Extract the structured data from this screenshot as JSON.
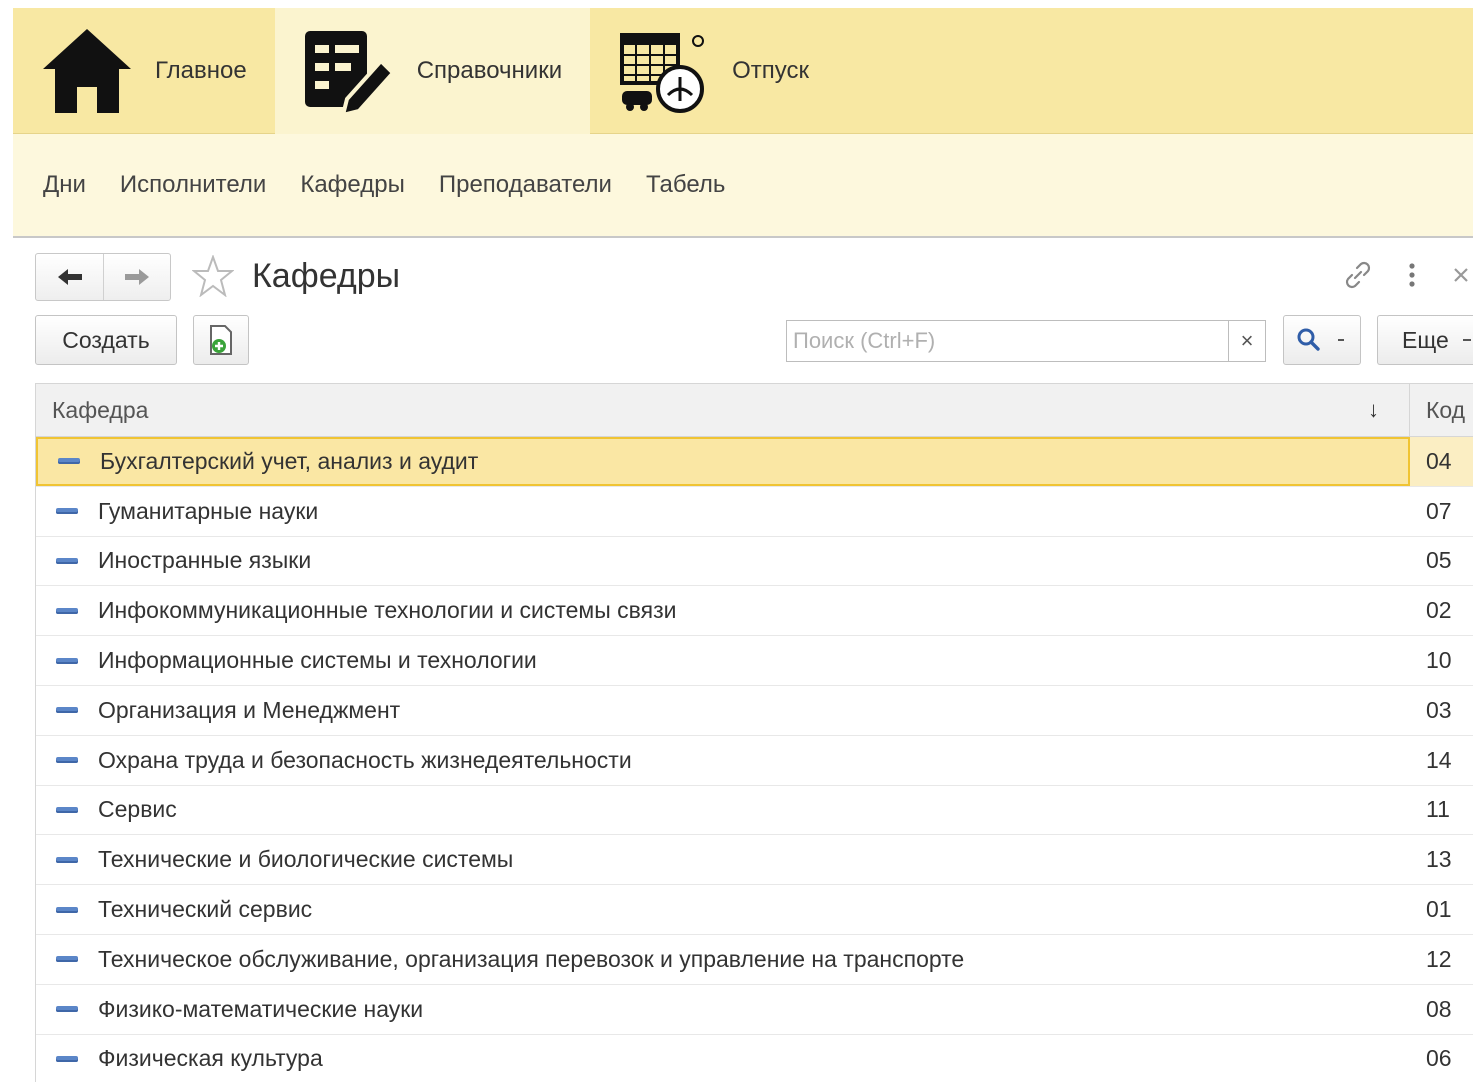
{
  "sections": [
    {
      "label": "Главное",
      "icon": "home-icon"
    },
    {
      "label": "Справочники",
      "icon": "catalog-edit-icon"
    },
    {
      "label": "Отпуск",
      "icon": "vacation-calendar-icon"
    }
  ],
  "subnav": [
    "Дни",
    "Исполнители",
    "Кафедры",
    "Преподаватели",
    "Табель"
  ],
  "form": {
    "title": "Кафедры",
    "create_label": "Создать",
    "search_placeholder": "Поиск (Ctrl+F)",
    "search_clear": "×",
    "more_label": "Еще"
  },
  "table": {
    "columns": [
      "Кафедра",
      "Код"
    ],
    "sort_indicator": "↓",
    "rows": [
      {
        "name": "Бухгалтерский учет, анализ и аудит",
        "code": "04",
        "selected": true
      },
      {
        "name": "Гуманитарные науки",
        "code": "07"
      },
      {
        "name": "Иностранные языки",
        "code": "05"
      },
      {
        "name": "Инфокоммуникационные технологии и системы связи",
        "code": "02"
      },
      {
        "name": "Информационные системы и технологии",
        "code": "10"
      },
      {
        "name": "Организация и Менеджмент",
        "code": "03"
      },
      {
        "name": "Охрана труда и безопасность жизнедеятельности",
        "code": "14"
      },
      {
        "name": "Сервис",
        "code": "11"
      },
      {
        "name": "Технические и биологические системы",
        "code": "13"
      },
      {
        "name": "Технический сервис",
        "code": "01"
      },
      {
        "name": "Техническое обслуживание, организация перевозок и управление на транспорте",
        "code": "12"
      },
      {
        "name": "Физико-математические науки",
        "code": "08"
      },
      {
        "name": "Физическая культура",
        "code": "06"
      }
    ]
  },
  "colors": {
    "section_bar": "#f8e8a3",
    "selected_row": "#f9e39a",
    "item_icon": "#5b86c8"
  }
}
